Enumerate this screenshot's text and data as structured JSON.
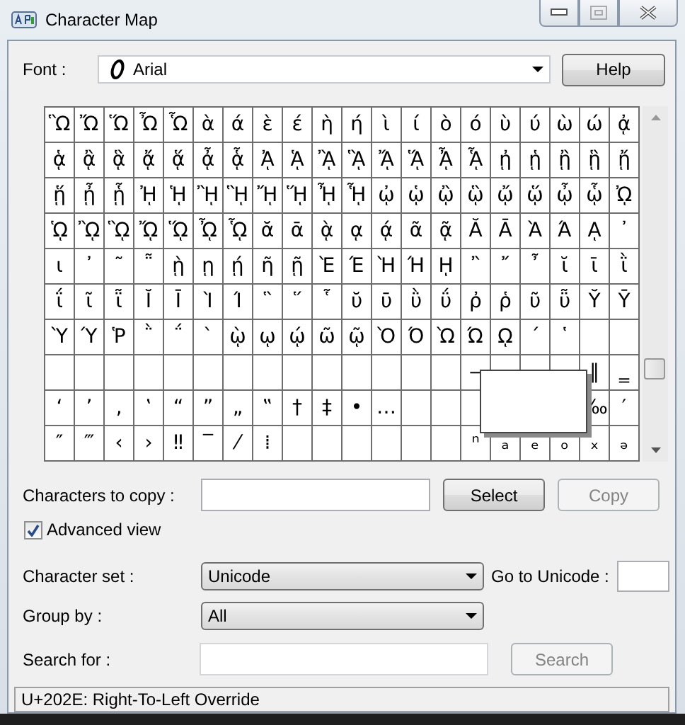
{
  "window": {
    "title": "Character Map"
  },
  "font": {
    "label": "Font :",
    "value": "Arial"
  },
  "help_button": "Help",
  "character_grid": {
    "rows": [
      [
        "Ὣ",
        "Ὤ",
        "Ὥ",
        "Ὦ",
        "Ὧ",
        "ὰ",
        "ά",
        "ὲ",
        "έ",
        "ὴ",
        "ή",
        "ὶ",
        "ί",
        "ὸ",
        "ό",
        "ὺ",
        "ύ",
        "ὼ",
        "ώ",
        "ᾀ"
      ],
      [
        "ᾁ",
        "ᾂ",
        "ᾃ",
        "ᾄ",
        "ᾅ",
        "ᾆ",
        "ᾇ",
        "ᾈ",
        "ᾉ",
        "ᾊ",
        "ᾋ",
        "ᾌ",
        "ᾍ",
        "ᾎ",
        "ᾏ",
        "ᾐ",
        "ᾑ",
        "ᾒ",
        "ᾓ",
        "ᾔ"
      ],
      [
        "ᾕ",
        "ᾖ",
        "ᾗ",
        "ᾘ",
        "ᾙ",
        "ᾚ",
        "ᾛ",
        "ᾜ",
        "ᾝ",
        "ᾞ",
        "ᾟ",
        "ᾠ",
        "ᾡ",
        "ᾢ",
        "ᾣ",
        "ᾤ",
        "ᾥ",
        "ᾦ",
        "ᾧ",
        "ᾨ"
      ],
      [
        "ᾩ",
        "ᾪ",
        "ᾫ",
        "ᾬ",
        "ᾭ",
        "ᾮ",
        "ᾯ",
        "ᾰ",
        "ᾱ",
        "ᾲ",
        "ᾳ",
        "ᾴ",
        "ᾶ",
        "ᾷ",
        "Ᾰ",
        "Ᾱ",
        "Ὰ",
        "Ά",
        "ᾼ",
        "᾽"
      ],
      [
        "ι",
        "᾿",
        "῀",
        "῁",
        "ῂ",
        "ῃ",
        "ῄ",
        "ῆ",
        "ῇ",
        "Ὲ",
        "Έ",
        "Ὴ",
        "Ή",
        "ῌ",
        "῍",
        "῎",
        "῏",
        "ῐ",
        "ῑ",
        "ῒ"
      ],
      [
        "ΐ",
        "ῖ",
        "ῗ",
        "Ῐ",
        "Ῑ",
        "Ὶ",
        "Ί",
        "῝",
        "῞",
        "῟",
        "ῠ",
        "ῡ",
        "ῢ",
        "ΰ",
        "ῤ",
        "ῥ",
        "ῦ",
        "ῧ",
        "Ῠ",
        "Ῡ"
      ],
      [
        "Ὺ",
        "Ύ",
        "Ῥ",
        "῭",
        "΅",
        "`",
        "ῲ",
        "ῳ",
        "ῴ",
        "ῶ",
        "ῷ",
        "Ὸ",
        "Ό",
        "Ὼ",
        "Ώ",
        "ῼ",
        "´",
        "῾",
        null,
        null
      ],
      [
        null,
        null,
        null,
        null,
        null,
        null,
        null,
        null,
        null,
        null,
        null,
        null,
        null,
        null,
        "‒",
        null,
        null,
        null,
        "‖",
        "‗"
      ],
      [
        "‘",
        "’",
        "‚",
        "‛",
        "“",
        "”",
        "„",
        "‟",
        "†",
        "‡",
        "•",
        "…",
        null,
        null,
        null,
        "",
        "",
        "",
        "‰",
        "′"
      ],
      [
        "″",
        "‴",
        "‹",
        "›",
        "‼",
        "‾",
        "⁄",
        "⁞",
        null,
        null,
        null,
        null,
        null,
        null,
        "ⁿ",
        "ₐ",
        "ₑ",
        "ₒ",
        "ₓ",
        "ₔ"
      ]
    ]
  },
  "copy": {
    "label": "Characters to copy :",
    "select_button": {
      "label": "Select",
      "disabled": false
    },
    "copy_button": {
      "label": "Copy",
      "disabled": true
    }
  },
  "advanced_view": {
    "label": "Advanced view",
    "checked": true
  },
  "character_set": {
    "label": "Character set :",
    "value": "Unicode"
  },
  "go_to_unicode": {
    "label": "Go to Unicode :"
  },
  "group_by": {
    "label": "Group by :",
    "value": "All"
  },
  "search": {
    "label": "Search for :",
    "button": {
      "label": "Search",
      "disabled": true
    }
  },
  "status_bar": "U+202E: Right-To-Left Override"
}
